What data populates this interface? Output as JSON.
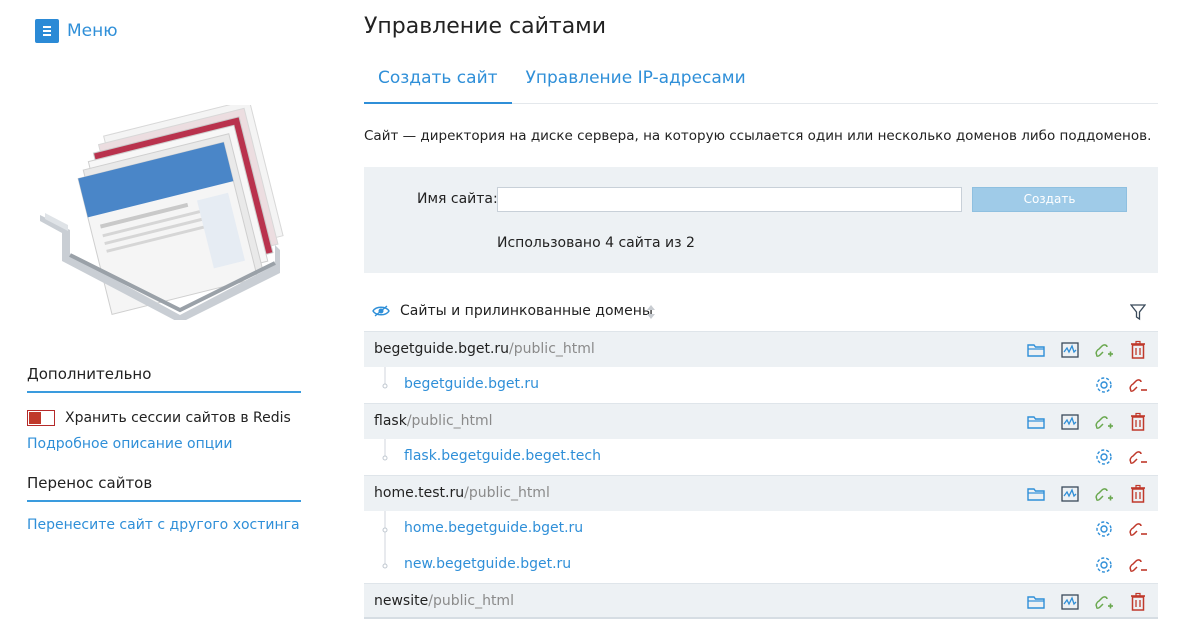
{
  "sidebar": {
    "menu_label": "Меню",
    "additional_title": "Дополнительно",
    "redis_label": "Хранить сессии сайтов в Redis",
    "redis_details_link": "Подробное описание опции",
    "transfer_title": "Перенос сайтов",
    "transfer_link": "Перенесите сайт с другого хостинга"
  },
  "main": {
    "title": "Управление сайтами",
    "tabs": [
      {
        "label": "Создать сайт",
        "active": true
      },
      {
        "label": "Управление IP-адресами",
        "active": false
      }
    ],
    "description": "Сайт — директория на диске сервера, на которую ссылается один или несколько доменов либо поддоменов.",
    "form": {
      "name_label": "Имя сайта:",
      "name_value": "",
      "create_button": "Создать",
      "usage_text": "Использовано 4 сайта из 2"
    },
    "table": {
      "header": "Сайты и прилинкованные домены",
      "sites": [
        {
          "name": "begetguide.bget.ru",
          "path": "/public_html",
          "domains": [
            "begetguide.bget.ru"
          ]
        },
        {
          "name": "flask",
          "path": "/public_html",
          "domains": [
            "flask.begetguide.beget.tech"
          ]
        },
        {
          "name": "home.test.ru",
          "path": "/public_html",
          "domains": [
            "home.begetguide.bget.ru",
            "new.begetguide.bget.ru"
          ]
        },
        {
          "name": "newsite",
          "path": "/public_html",
          "domains": []
        }
      ]
    }
  },
  "colors": {
    "accent": "#2f8fd8",
    "panel_bg": "#edf1f4",
    "delete_red": "#c0392b",
    "add_green": "#6aa84f"
  },
  "icons": {
    "site_row": [
      "folder-icon",
      "activity-icon",
      "link-add-icon",
      "trash-icon"
    ],
    "domain_row": [
      "settings-gear-icon",
      "unlink-icon"
    ]
  }
}
